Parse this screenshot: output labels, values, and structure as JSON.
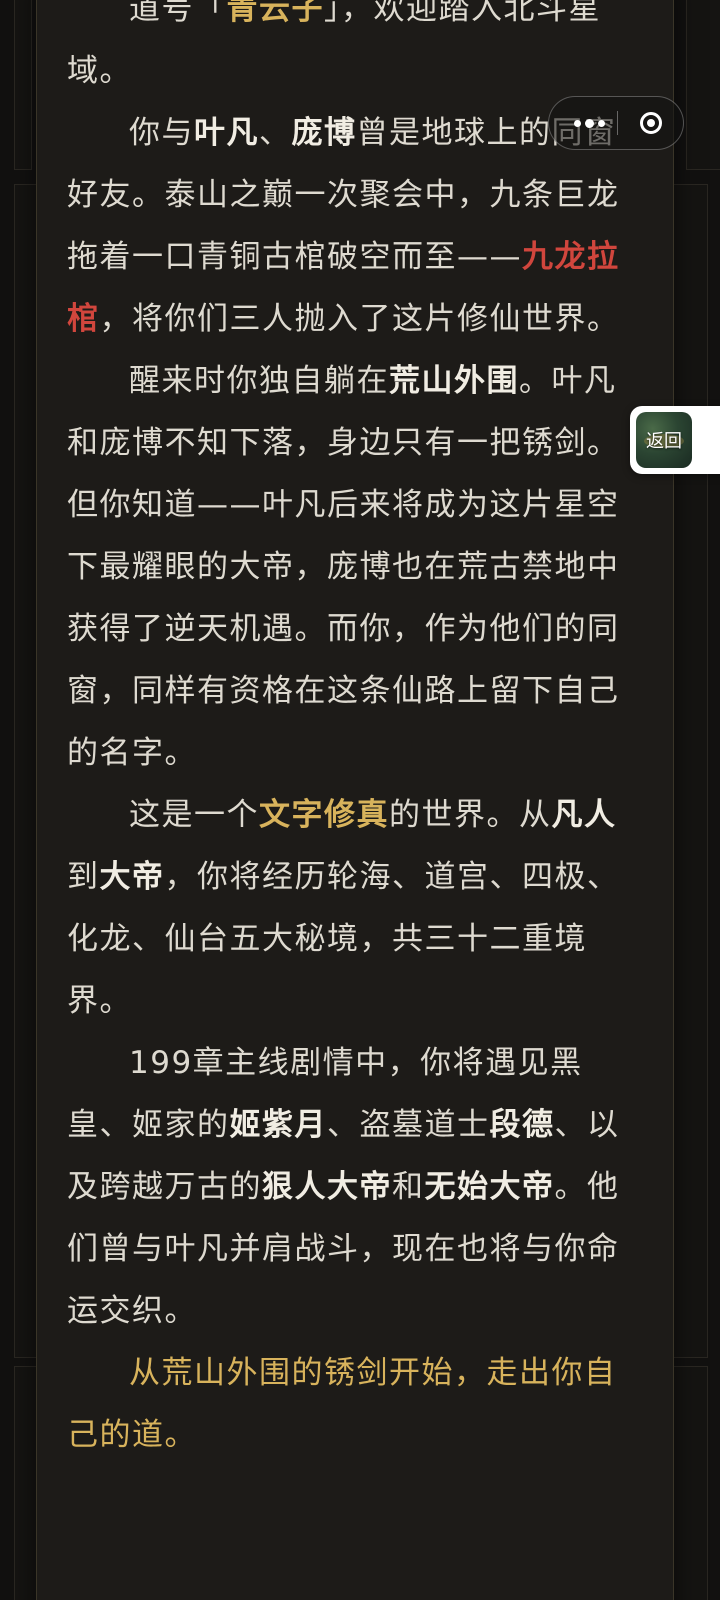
{
  "story": {
    "p0": {
      "a": "道号「",
      "name": "青云子",
      "b": "」，欢迎踏入北斗星域。"
    },
    "p1": {
      "a": "你与",
      "ye_fan": "叶凡",
      "sep": "、",
      "pang_bo": "庞博",
      "b": "曾是地球上的同窗好友。泰山之巅一次聚会中，九条巨龙拖着一口青铜古棺破空而至——",
      "coffin": "九龙拉棺",
      "c": "，将你们三人抛入了这片修仙世界。"
    },
    "p2": {
      "a": "醒来时你独自躺在",
      "place": "荒山外围",
      "b": "。叶凡和庞博不知下落，身边只有一把锈剑。但你知道——叶凡后来将成为这片星空下最耀眼的大帝，庞博也在荒古禁地中获得了逆天机遇。而你，作为他们的同窗，同样有资格在这条仙路上留下自己的名字。"
    },
    "p3": {
      "a": "这是一个",
      "genre": "文字修真",
      "b": "的世界。从",
      "mortal": "凡人",
      "c": "到",
      "emperor": "大帝",
      "d": "，你将经历轮海、道宫、四极、化龙、仙台五大秘境，共三十二重境界。"
    },
    "p4": {
      "a": "199章主线剧情中，你将遇见黑皇、姬家的",
      "ji_ziyue": "姬紫月",
      "b": "、盗墓道士",
      "duan_de": "段德",
      "c": "、以及跨越万古的",
      "hen_ren": "狠人大帝",
      "d": "和",
      "wu_shi": "无始大帝",
      "e": "。他们曾与叶凡并肩战斗，现在也将与你命运交织。"
    },
    "p5": {
      "text": "从荒山外围的锈剑开始，走出你自己的道。"
    }
  },
  "capsule": {
    "more_icon": "more-dots-icon",
    "close_icon": "target-circle-icon"
  },
  "back_float": {
    "label": "返回"
  },
  "colors": {
    "background": "#121110",
    "card": "#1d1b18",
    "text": "#dedad0",
    "gold": "#d8b35c",
    "red": "#d1463d"
  }
}
